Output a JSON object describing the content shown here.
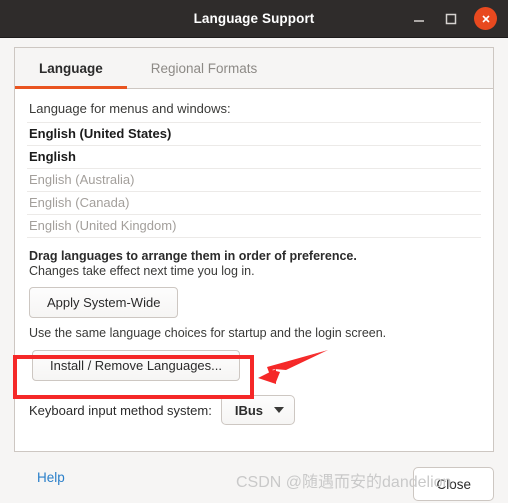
{
  "window": {
    "title": "Language Support",
    "controls": {
      "minimize": "minimize",
      "maximize": "maximize",
      "close": "close"
    }
  },
  "tabs": [
    {
      "label": "Language",
      "active": true
    },
    {
      "label": "Regional Formats",
      "active": false
    }
  ],
  "main": {
    "menus_label": "Language for menus and windows:",
    "languages": [
      {
        "name": "English (United States)",
        "state": "enabled"
      },
      {
        "name": "English",
        "state": "enabled"
      },
      {
        "name": "English (Australia)",
        "state": "disabled"
      },
      {
        "name": "English (Canada)",
        "state": "disabled"
      },
      {
        "name": "English (United Kingdom)",
        "state": "disabled"
      }
    ],
    "drag_hint": "Drag languages to arrange them in order of preference.",
    "changes_hint": "Changes take effect next time you log in.",
    "apply_button": "Apply System-Wide",
    "apply_note": "Use the same language choices for startup and the login screen.",
    "install_button": "Install / Remove Languages...",
    "keyboard_label": "Keyboard input method system:",
    "keyboard_value": "IBus",
    "keyboard_caret_icon": "chevron-down-icon"
  },
  "footer": {
    "help_label": "Help",
    "close_label": "Close"
  },
  "watermark": "CSDN @随遇而安的dandelion",
  "annotations": {
    "highlight_target": "Install / Remove Languages...",
    "box_color": "#f52828",
    "arrow_color": "#f52828"
  },
  "colors": {
    "titlebar_bg": "#2f2c2b",
    "accent": "#e95420",
    "close_button": "#e8491f",
    "link": "#2a7fc9",
    "panel_bg": "#f6f5f4",
    "content_bg": "#ffffff"
  }
}
